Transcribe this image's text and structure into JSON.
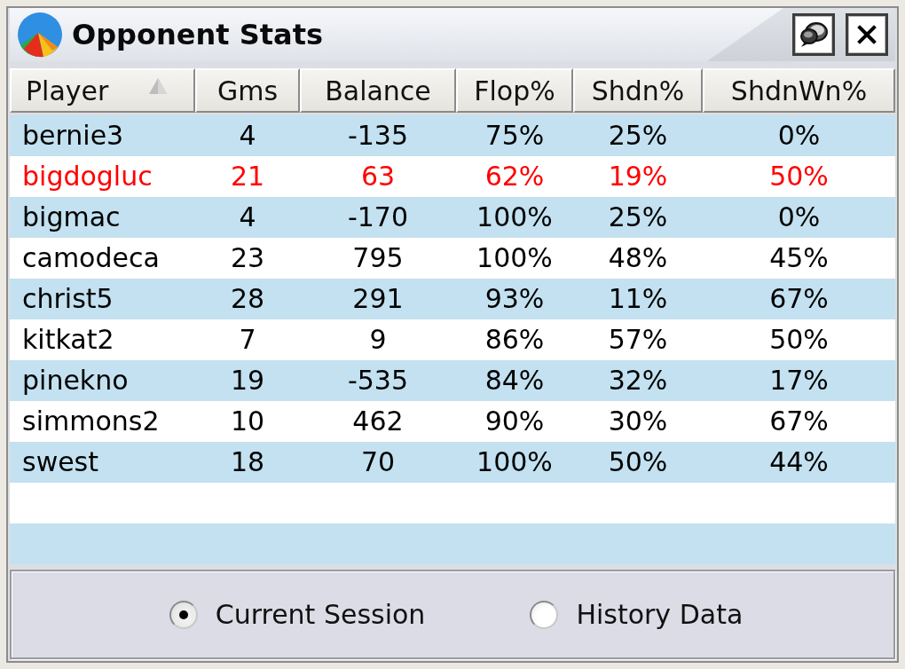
{
  "window": {
    "title": "Opponent Stats"
  },
  "table": {
    "columns": [
      {
        "label": "Player",
        "sorted": true
      },
      {
        "label": "Gms",
        "sorted": false
      },
      {
        "label": "Balance",
        "sorted": false
      },
      {
        "label": "Flop%",
        "sorted": false
      },
      {
        "label": "Shdn%",
        "sorted": false
      },
      {
        "label": "ShdnWn%",
        "sorted": false
      }
    ],
    "rows": [
      {
        "cells": [
          "bernie3",
          "4",
          "-135",
          "75%",
          "25%",
          "0%"
        ],
        "color": "#000000"
      },
      {
        "cells": [
          "bigdogluc",
          "21",
          "63",
          "62%",
          "19%",
          "50%"
        ],
        "color": "#ff0000"
      },
      {
        "cells": [
          "bigmac",
          "4",
          "-170",
          "100%",
          "25%",
          "0%"
        ],
        "color": "#000000"
      },
      {
        "cells": [
          "camodeca",
          "23",
          "795",
          "100%",
          "48%",
          "45%"
        ],
        "color": "#000000"
      },
      {
        "cells": [
          "christ5",
          "28",
          "291",
          "93%",
          "11%",
          "67%"
        ],
        "color": "#000000"
      },
      {
        "cells": [
          "kitkat2",
          "7",
          "9",
          "86%",
          "57%",
          "50%"
        ],
        "color": "#000000"
      },
      {
        "cells": [
          "pinekno",
          "19",
          "-535",
          "84%",
          "32%",
          "17%"
        ],
        "color": "#000000"
      },
      {
        "cells": [
          "simmons2",
          "10",
          "462",
          "90%",
          "30%",
          "67%"
        ],
        "color": "#000000"
      },
      {
        "cells": [
          "swest",
          "18",
          "70",
          "100%",
          "50%",
          "44%"
        ],
        "color": "#000000"
      }
    ]
  },
  "data_source": {
    "options": [
      {
        "label": "Current Session",
        "selected": true
      },
      {
        "label": "History Data",
        "selected": false
      }
    ]
  }
}
